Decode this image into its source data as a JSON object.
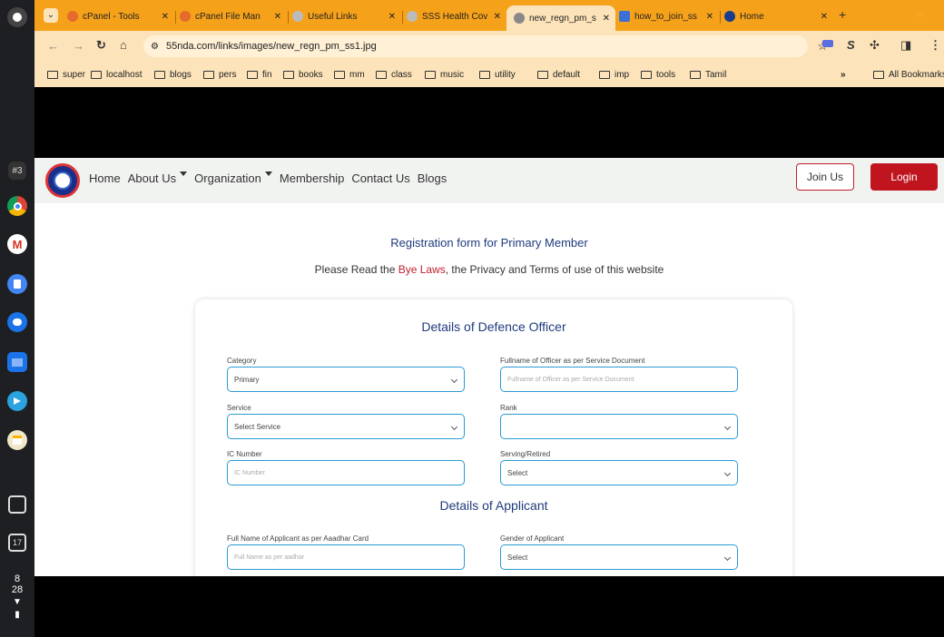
{
  "shelf": {
    "badge": "#3",
    "calendar_day": "17",
    "time_hour": "8",
    "time_min": "28"
  },
  "tabs": [
    {
      "title": "cPanel - Tools",
      "fav": "#e46b2b"
    },
    {
      "title": "cPanel File Man",
      "fav": "#e46b2b"
    },
    {
      "title": "Useful Links",
      "fav": "#999"
    },
    {
      "title": "SSS Health Cov",
      "fav": "#999"
    },
    {
      "title": "new_regn_pm_s",
      "fav": "#777"
    },
    {
      "title": "how_to_join_ss",
      "fav": "#3a6fd8"
    },
    {
      "title": "Home",
      "fav": "#1a3c8a"
    }
  ],
  "address": {
    "url": "55nda.com/links/images/new_regn_pm_ss1.jpg"
  },
  "bookmarks": [
    "super",
    "localhost",
    "blogs",
    "pers",
    "fin",
    "books",
    "mm",
    "class",
    "music",
    "utility",
    "default",
    "imp",
    "tools",
    "Tamil"
  ],
  "all_bookmarks": "All Bookmarks",
  "nav": {
    "home": "Home",
    "about": "About Us",
    "organization": "Organization",
    "membership": "Membership",
    "contact": "Contact Us",
    "blogs": "Blogs",
    "join": "Join Us",
    "login": "Login"
  },
  "form": {
    "title": "Registration form for Primary Member",
    "sub_before": "Please Read the ",
    "sub_link": "Bye Laws",
    "sub_after": ", the Privacy and Terms of use of this website",
    "section1": "Details of Defence Officer",
    "section2": "Details of Applicant",
    "category_label": "Category",
    "category_value": "Primary",
    "fullname_label": "Fullname of Officer as per Service Document",
    "fullname_placeholder": "Fullname of Officer as per Service Document",
    "service_label": "Service",
    "service_value": "Select Service",
    "rank_label": "Rank",
    "rank_value": "",
    "ic_label": "IC Number",
    "ic_placeholder": "IC Number",
    "serving_label": "Serving/Retired",
    "serving_value": "Select",
    "applicant_label": "Full Name of Applicant as per Aaadhar Card",
    "applicant_placeholder": "Full Name as per aadhar",
    "gender_label": "Gender of Applicant",
    "gender_value": "Select"
  }
}
